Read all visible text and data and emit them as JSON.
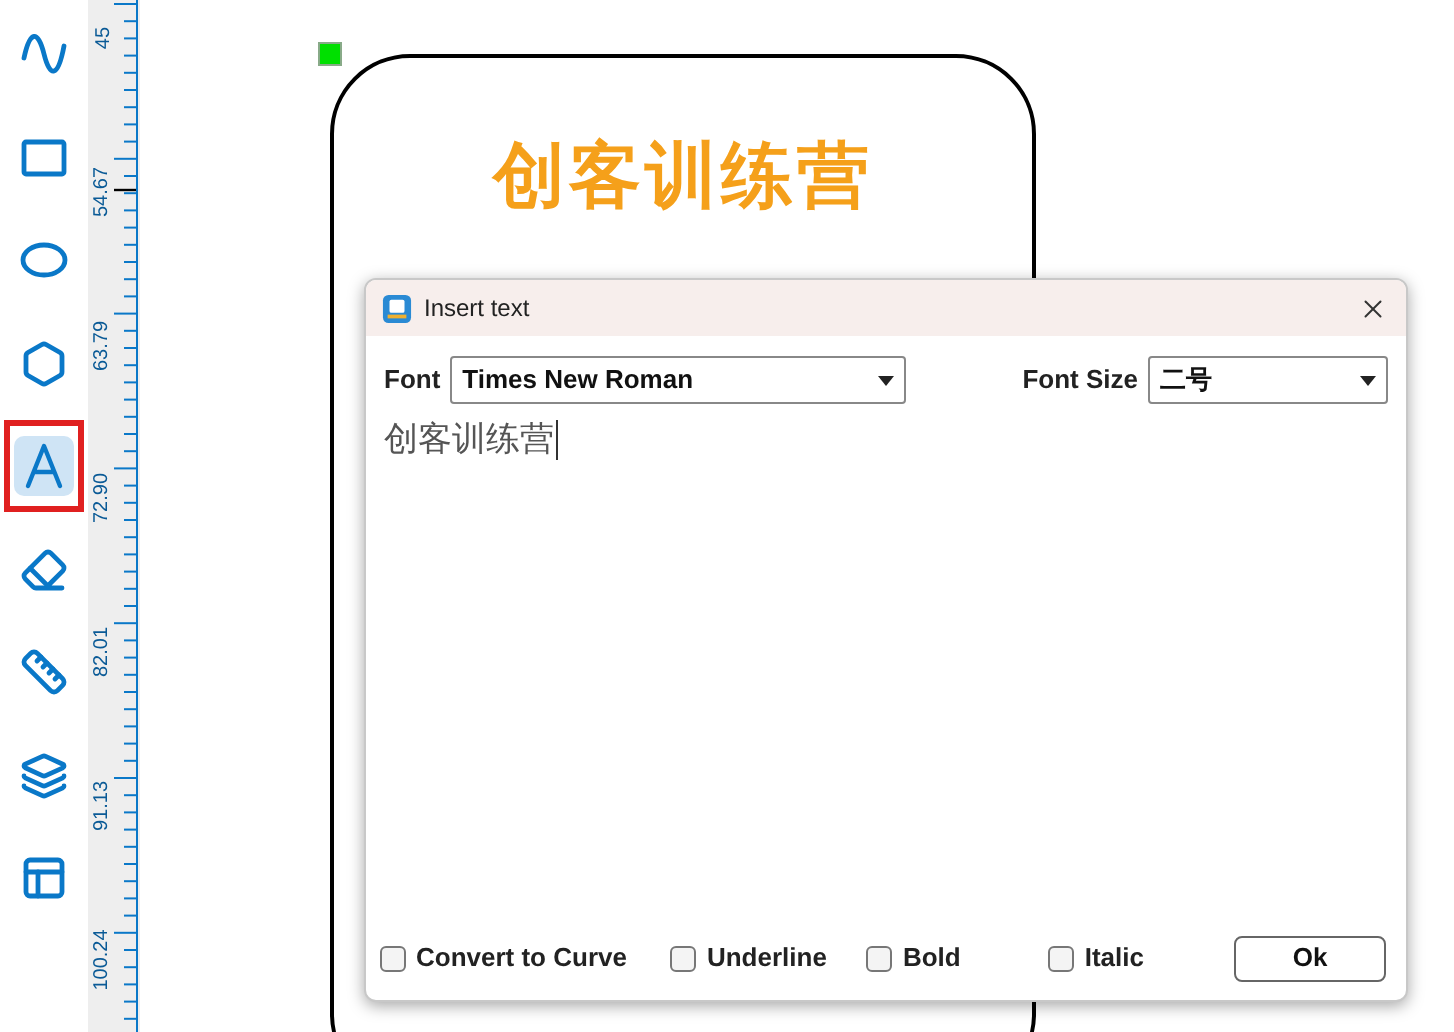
{
  "toolbar": {
    "tools": [
      {
        "kind": "curve",
        "selected": false
      },
      {
        "kind": "rectangle",
        "selected": false
      },
      {
        "kind": "ellipse",
        "selected": false
      },
      {
        "kind": "polygon",
        "selected": false
      },
      {
        "kind": "text",
        "selected": true
      },
      {
        "kind": "eraser",
        "selected": false
      },
      {
        "kind": "measure",
        "selected": false
      },
      {
        "kind": "layers",
        "selected": false
      },
      {
        "kind": "layout",
        "selected": false
      }
    ]
  },
  "ruler": {
    "labels": [
      "45",
      "54.67",
      "63.79",
      "72.90",
      "82.01",
      "91.13",
      "100.24"
    ]
  },
  "canvas": {
    "shape": {
      "text": "创客训练营"
    }
  },
  "dialog": {
    "title": "Insert text",
    "font": {
      "label": "Font",
      "value": "Times New Roman"
    },
    "font_size": {
      "label": "Font Size",
      "value": "二号"
    },
    "text_value": "创客训练营",
    "options": [
      {
        "label": "Convert to Curve",
        "checked": false
      },
      {
        "label": "Underline",
        "checked": false
      },
      {
        "label": "Bold",
        "checked": false
      },
      {
        "label": "Italic",
        "checked": false
      }
    ],
    "ok_button": "Ok"
  }
}
